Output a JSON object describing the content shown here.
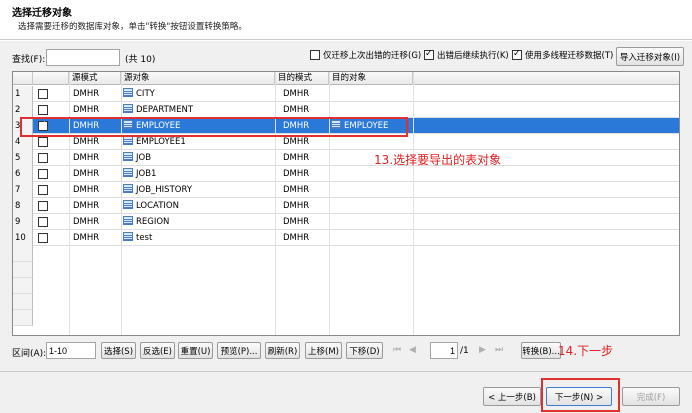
{
  "header": {
    "title": "选择迁移对象",
    "description": "选择需要迁移的数据库对象，单击\"转换\"按钮设置转换策略。"
  },
  "toolbar": {
    "search_label": "查找(F):",
    "search_value": "",
    "count": "(共 10)",
    "opt_last_error": "仅迁移上次出错的迁移(G)",
    "opt_continue_on_error": "出错后继续执行(K)",
    "opt_multithread": "使用多线程迁移数据(T)",
    "import_button": "导入迁移对象(I)",
    "opt_last_error_checked": false,
    "opt_continue_on_error_checked": true,
    "opt_multithread_checked": true
  },
  "table": {
    "columns": [
      "源模式",
      "源对象",
      "目的模式",
      "目的对象"
    ],
    "rows": [
      {
        "num": "1",
        "checked": false,
        "src_schema": "DMHR",
        "src_object": "CITY",
        "dst_schema": "DMHR",
        "dst_object": ""
      },
      {
        "num": "2",
        "checked": false,
        "src_schema": "DMHR",
        "src_object": "DEPARTMENT",
        "dst_schema": "DMHR",
        "dst_object": ""
      },
      {
        "num": "3",
        "checked": true,
        "src_schema": "DMHR",
        "src_object": "EMPLOYEE",
        "dst_schema": "DMHR",
        "dst_object": "EMPLOYEE"
      },
      {
        "num": "4",
        "checked": false,
        "src_schema": "DMHR",
        "src_object": "EMPLOYEE1",
        "dst_schema": "DMHR",
        "dst_object": ""
      },
      {
        "num": "5",
        "checked": false,
        "src_schema": "DMHR",
        "src_object": "JOB",
        "dst_schema": "DMHR",
        "dst_object": ""
      },
      {
        "num": "6",
        "checked": false,
        "src_schema": "DMHR",
        "src_object": "JOB1",
        "dst_schema": "DMHR",
        "dst_object": ""
      },
      {
        "num": "7",
        "checked": false,
        "src_schema": "DMHR",
        "src_object": "JOB_HISTORY",
        "dst_schema": "DMHR",
        "dst_object": ""
      },
      {
        "num": "8",
        "checked": false,
        "src_schema": "DMHR",
        "src_object": "LOCATION",
        "dst_schema": "DMHR",
        "dst_object": ""
      },
      {
        "num": "9",
        "checked": false,
        "src_schema": "DMHR",
        "src_object": "REGION",
        "dst_schema": "DMHR",
        "dst_object": ""
      },
      {
        "num": "10",
        "checked": false,
        "src_schema": "DMHR",
        "src_object": "test",
        "dst_schema": "DMHR",
        "dst_object": ""
      }
    ],
    "selected_row": "3"
  },
  "annotations": {
    "step13": "13.选择要导出的表对象",
    "step14": "14.下一步"
  },
  "bottom_bar": {
    "range_label": "区间(A):",
    "range_value": "1-10",
    "select_button": "选择(S)",
    "invert_button": "反选(E)",
    "reset_button": "重置(U)",
    "preview_button": "预览(P)...",
    "refresh_button": "刷新(R)",
    "move_up_button": "上移(M)",
    "move_down_button": "下移(D)",
    "page_value": "1",
    "page_total": "/1",
    "convert_button": "转换(B)..."
  },
  "footer": {
    "prev_button": "< 上一步(B)",
    "next_button": "下一步(N) >",
    "finish_button": "完成(F)"
  },
  "colors": {
    "selection": "#2a78d8",
    "annotation": "#e02020"
  }
}
